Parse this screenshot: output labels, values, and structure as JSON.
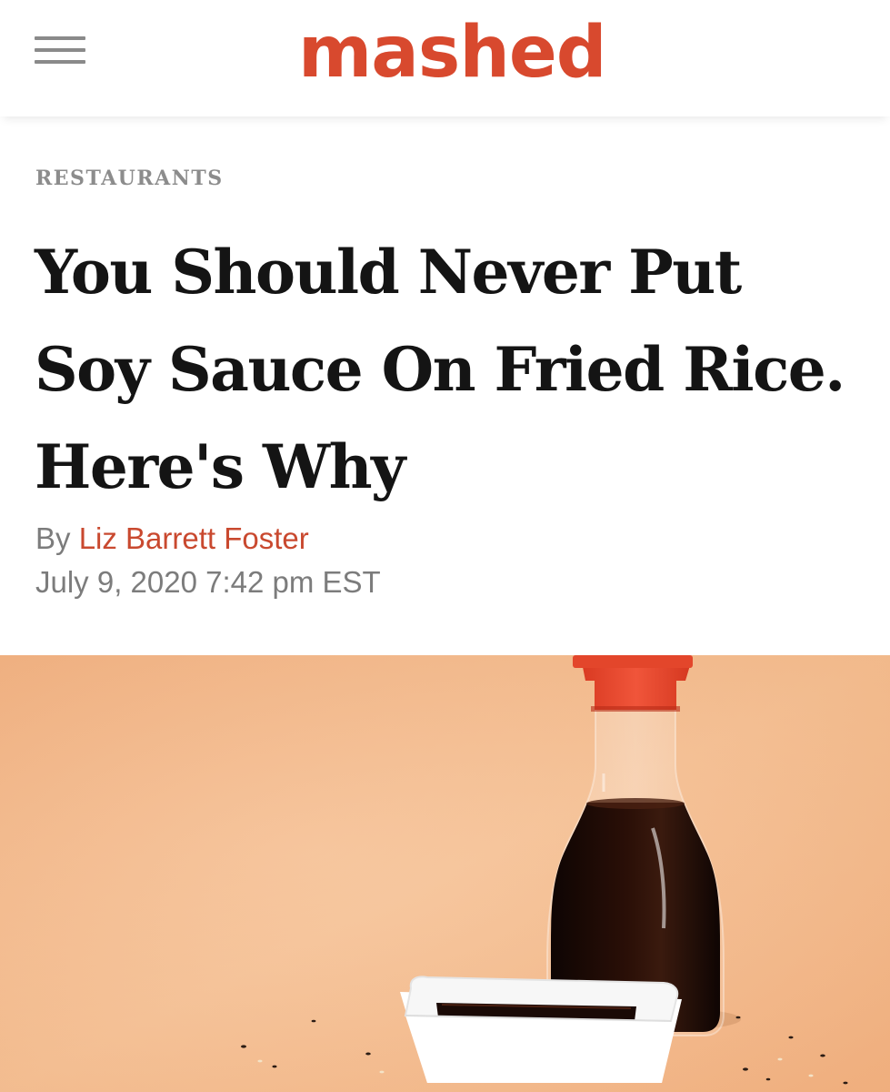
{
  "header": {
    "logo_text": "mashed",
    "menu_icon": "hamburger-menu-icon",
    "brand_color": "#d8492e"
  },
  "article": {
    "category": "RESTAURANTS",
    "title": "You Should Never Put Soy Sauce On Fried Rice. Here's Why",
    "byline_prefix": "By",
    "author": "Liz Barrett Foster",
    "date": "July 9, 2020 7:42 pm EST"
  },
  "hero_image": {
    "subject": "soy-sauce-bottle-and-dish",
    "background_color": "#f3b98a",
    "cap_color": "#e5452a",
    "sauce_color": "#1a0a06"
  }
}
